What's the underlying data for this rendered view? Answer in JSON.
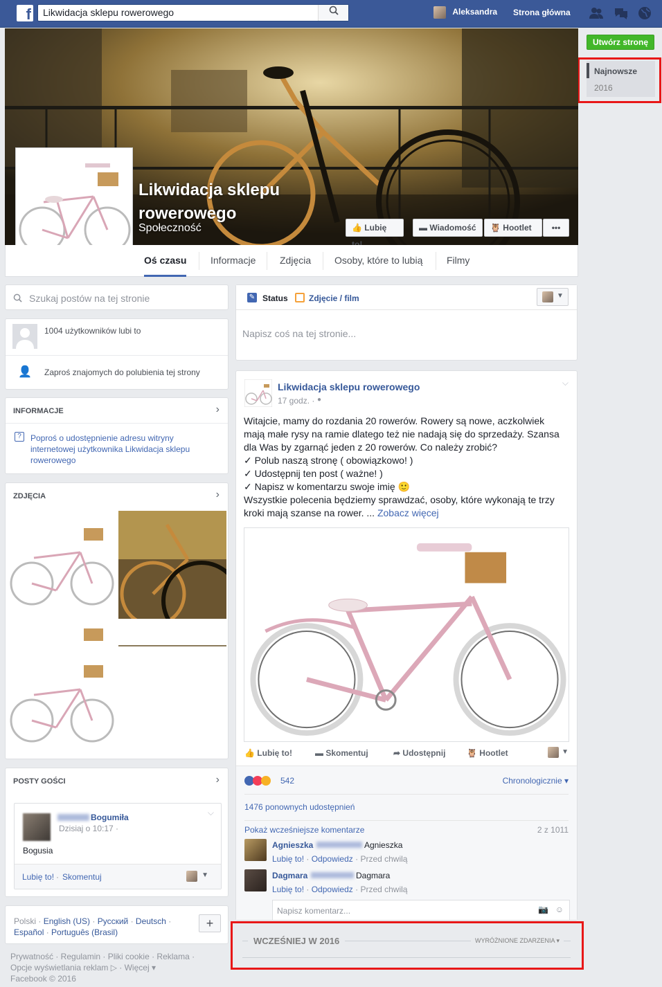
{
  "topbar": {
    "search_value": "Likwidacja sklepu rowerowego",
    "user": "Aleksandra",
    "home": "Strona główna"
  },
  "right": {
    "create_page": "Utwórz stronę",
    "newest": "Najnowsze",
    "year": "2016"
  },
  "page": {
    "name_line1": "Likwidacja sklepu",
    "name_line2": "rowerowego",
    "category": "Społeczność",
    "buttons": {
      "like": "Lubię to!",
      "message": "Wiadomość",
      "hootlet": "Hootlet",
      "more": "•••"
    },
    "tabs": [
      "Oś czasu",
      "Informacje",
      "Zdjęcia",
      "Osoby, które to lubią",
      "Filmy"
    ]
  },
  "left": {
    "search_placeholder": "Szukaj postów na tej stronie",
    "likes": "1004 użytkowników lubi to",
    "invite": "Zaproś znajomych do polubienia tej strony",
    "info_h": "INFORMACJE",
    "info_link": "Poproś o udostępnienie adresu witryny internetowej użytkownika Likwidacja sklepu rowerowego",
    "photos_h": "ZDJĘCIA",
    "guest_h": "POSTY GOŚCI",
    "guest_name": "Bogumiła",
    "guest_time": "Dzisiaj o 10:17 ·",
    "guest_text": "Bogusia",
    "guest_like": "Lubię to!",
    "guest_sep": " · ",
    "guest_comment": "Skomentuj",
    "langs": {
      "l1": "Polski",
      "l2": "English (US)",
      "l3": "Русский",
      "l4": "Deutsch",
      "l5": "Español",
      "l6": "Português (Brasil)"
    },
    "footer": {
      "f1": "Prywatność · Regulamin · Pliki cookie · Reklama ·",
      "f2": "Opcje wyświetlania reklam ▷ · Więcej ▾",
      "f3": "Facebook © 2016"
    }
  },
  "composer": {
    "status": "Status",
    "photo": "Zdjęcie / film",
    "placeholder": "Napisz coś na tej stronie..."
  },
  "post": {
    "author": "Likwidacja sklepu rowerowego",
    "time": "17 godz. ·",
    "lines": [
      "Witajcie, mamy do rozdania 20 rowerów. Rowery są nowe, aczkolwiek",
      "mają małe rysy na ramie dlatego też nie nadają się do sprzedaży. Szansa",
      "dla Was by zgarnąć jeden z 20 rowerów. Co należy zrobić?",
      "✓ Polub naszą stronę ( obowiązkowo! )",
      "✓ Udostępnij ten post ( ważne! )",
      "✓ Napisz w komentarzu swoje imię 🙂",
      "Wszystkie polecenia będziemy sprawdzać, osoby, które wykonają te trzy",
      "kroki mają szanse na rower. ..."
    ],
    "see_more": "Zobacz więcej",
    "actions": {
      "like": "Lubię to!",
      "comment": "Skomentuj",
      "share": "Udostępnij",
      "hootlet": "Hootlet"
    },
    "reactions": "542",
    "sort": "Chronologicznie",
    "shares": "1476 ponownych udostępnień",
    "prev_comments": "Pokaż wcześniejsze komentarze",
    "count": "2 z 1011",
    "comments": [
      {
        "name": "Agnieszka",
        "name2": "Agnieszka",
        "like": "Lubię to!",
        "reply": "Odpowiedz",
        "time": "Przed chwilą"
      },
      {
        "name": "Dagmara",
        "name2": "Dagmara",
        "like": "Lubię to!",
        "reply": "Odpowiedz",
        "time": "Przed chwilą"
      }
    ],
    "comment_placeholder": "Napisz komentarz..."
  },
  "earlier": {
    "title": "WCZEŚNIEJ W 2016",
    "highlights": "WYRÓŻNIONE ZDARZENIA"
  }
}
